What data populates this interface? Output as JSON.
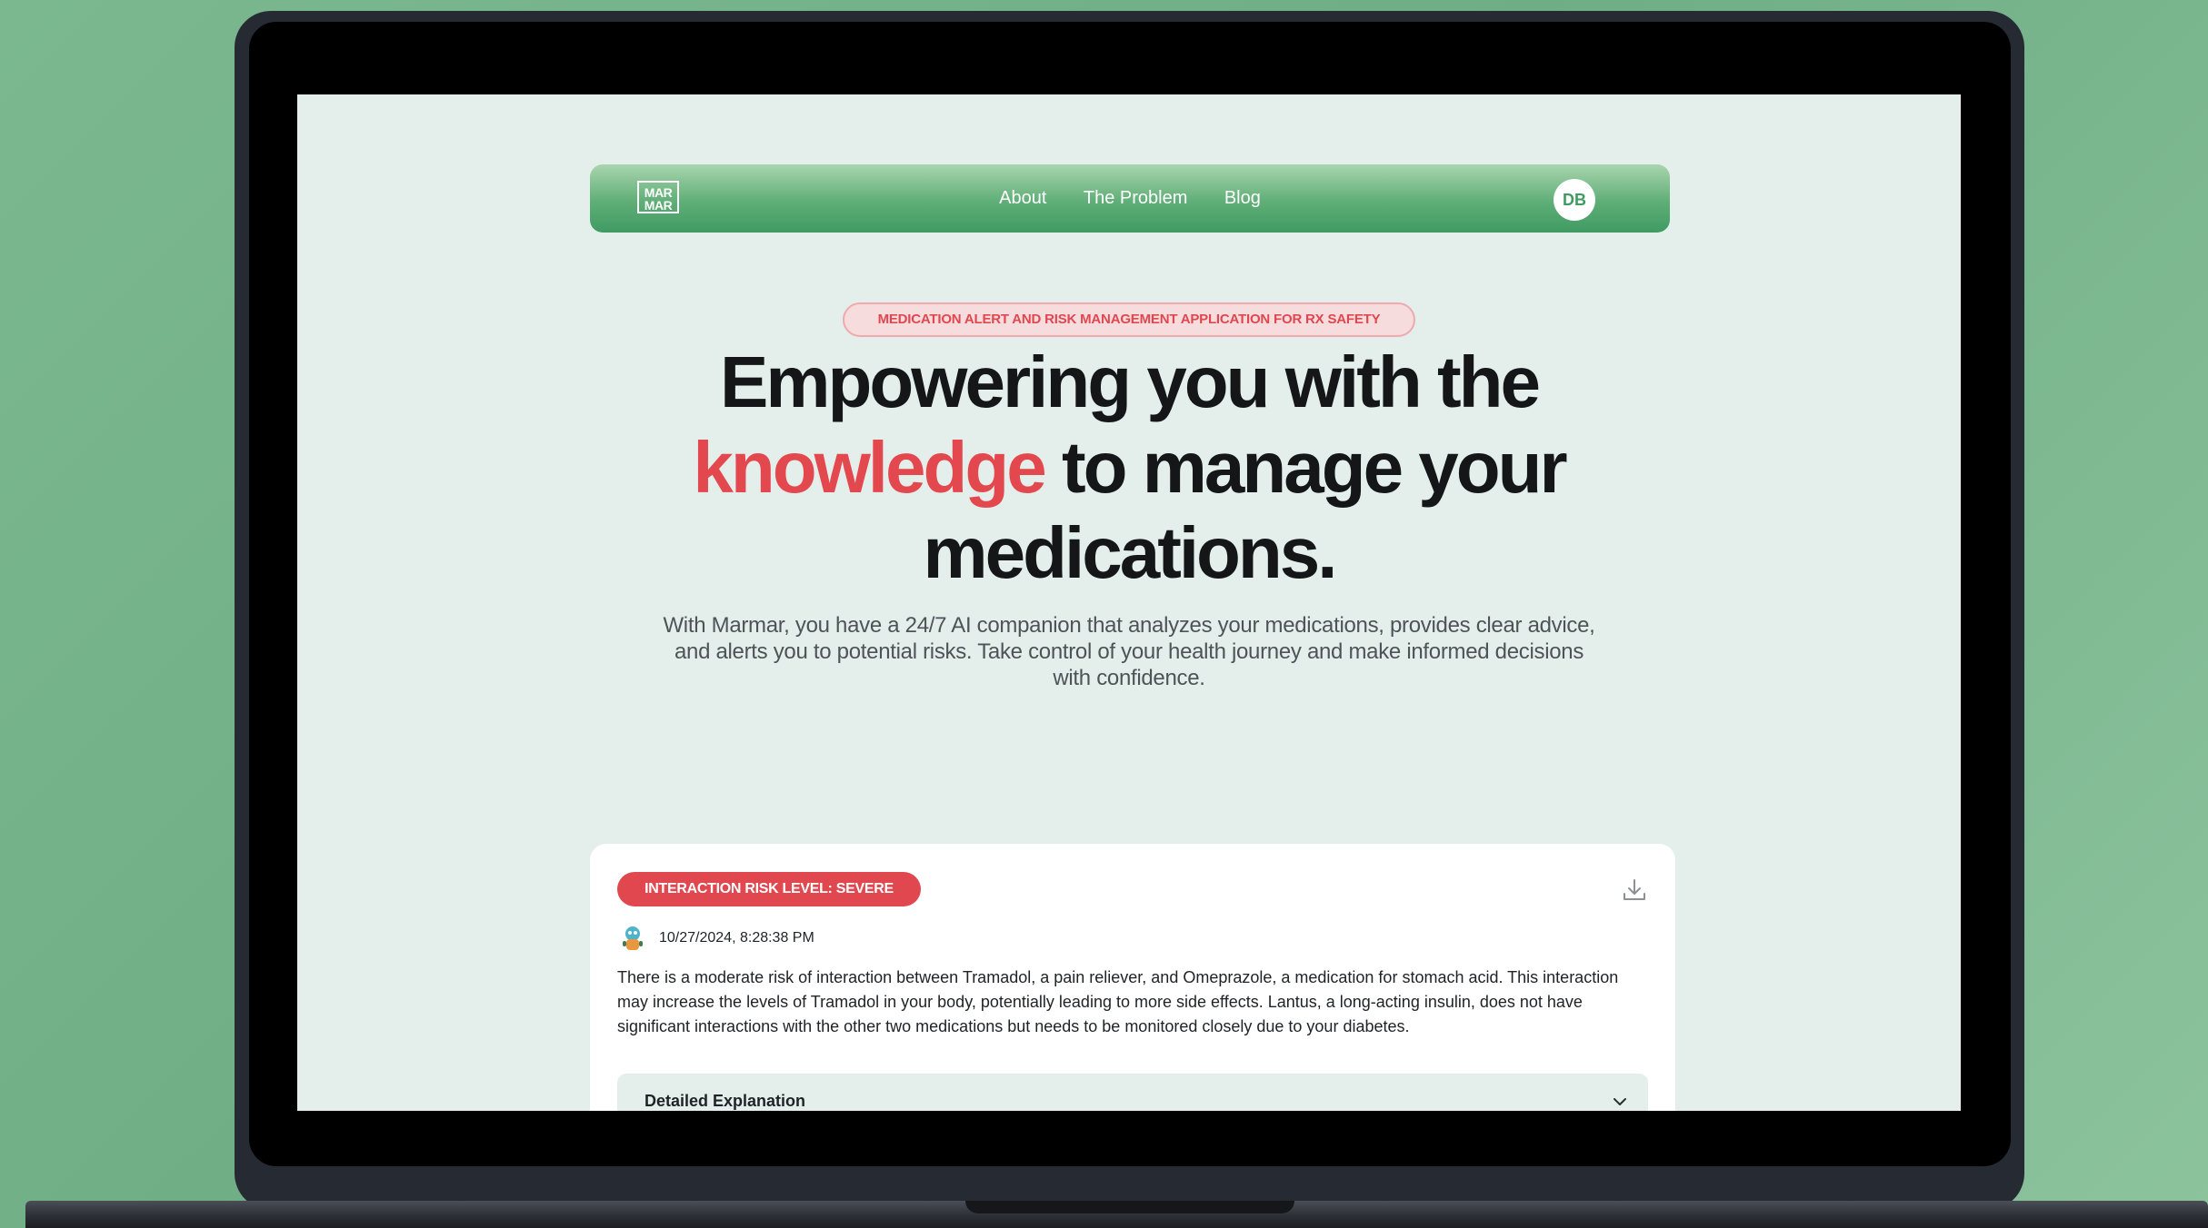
{
  "nav": {
    "logo_line1": "MAR",
    "logo_line2": "MAR",
    "links": [
      "About",
      "The Problem",
      "Blog"
    ],
    "avatar_initials": "DB"
  },
  "hero": {
    "tag": "MEDICATION ALERT AND RISK MANAGEMENT APPLICATION FOR RX SAFETY",
    "headline_part1": "Empowering you with the",
    "headline_accent": "knowledge",
    "headline_part2": "to manage your",
    "headline_part3": "medications.",
    "subtext": "With  Marmar, you have a 24/7 AI companion that analyzes your medications, provides clear advice, and alerts you to potential risks. Take control of your health journey and make informed decisions with confidence."
  },
  "card": {
    "risk_badge": "INTERACTION RISK LEVEL: SEVERE",
    "timestamp": "10/27/2024, 8:28:38 PM",
    "summary": "There is a moderate risk of interaction between Tramadol, a pain reliever, and Omeprazole, a medication for stomach acid. This interaction may increase the levels of Tramadol in your body, potentially leading to more side effects. Lantus, a long-acting insulin, does not have significant interactions with the other two medications but needs to be monitored closely due to your diabetes.",
    "accordion_label": "Detailed Explanation"
  },
  "icons": {
    "download": "download-icon",
    "chevron": "chevron-down-icon",
    "bot": "bot-avatar-icon"
  },
  "colors": {
    "brand_green": "#3f9b62",
    "accent_red": "#e4484f",
    "page_bg": "#e4efec"
  }
}
